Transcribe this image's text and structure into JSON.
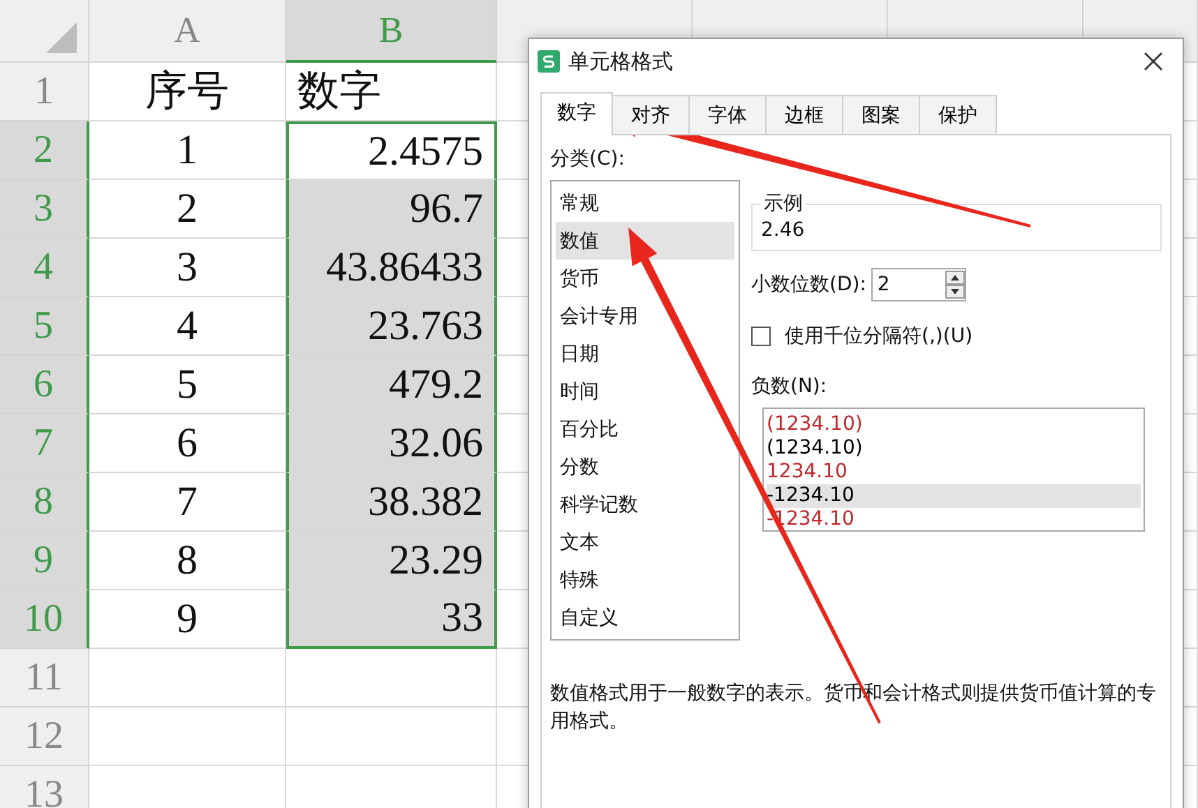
{
  "sheet": {
    "columns": [
      {
        "label": "A",
        "selected": false
      },
      {
        "label": "B",
        "selected": true
      }
    ],
    "rows": [
      {
        "header": "1",
        "selected": false,
        "cells": [
          {
            "text": "序号",
            "selected": false
          },
          {
            "text": "数字",
            "selected": false
          }
        ]
      },
      {
        "header": "2",
        "selected": true,
        "cells": [
          {
            "text": "1",
            "selected": false
          },
          {
            "text": "2.4575",
            "selected": true
          }
        ]
      },
      {
        "header": "3",
        "selected": true,
        "cells": [
          {
            "text": "2",
            "selected": false
          },
          {
            "text": "96.7",
            "selected": true
          }
        ]
      },
      {
        "header": "4",
        "selected": true,
        "cells": [
          {
            "text": "3",
            "selected": false
          },
          {
            "text": "43.86433",
            "selected": true
          }
        ]
      },
      {
        "header": "5",
        "selected": true,
        "cells": [
          {
            "text": "4",
            "selected": false
          },
          {
            "text": "23.763",
            "selected": true
          }
        ]
      },
      {
        "header": "6",
        "selected": true,
        "cells": [
          {
            "text": "5",
            "selected": false
          },
          {
            "text": "479.2",
            "selected": true
          }
        ]
      },
      {
        "header": "7",
        "selected": true,
        "cells": [
          {
            "text": "6",
            "selected": false
          },
          {
            "text": "32.06",
            "selected": true
          }
        ]
      },
      {
        "header": "8",
        "selected": true,
        "cells": [
          {
            "text": "7",
            "selected": false
          },
          {
            "text": "38.382",
            "selected": true
          }
        ]
      },
      {
        "header": "9",
        "selected": true,
        "cells": [
          {
            "text": "8",
            "selected": false
          },
          {
            "text": "23.29",
            "selected": true
          }
        ]
      },
      {
        "header": "10",
        "selected": true,
        "cells": [
          {
            "text": "9",
            "selected": false
          },
          {
            "text": "33",
            "selected": true
          }
        ]
      },
      {
        "header": "11",
        "selected": false,
        "cells": []
      },
      {
        "header": "12",
        "selected": false,
        "cells": []
      },
      {
        "header": "13",
        "selected": false,
        "cells": []
      }
    ]
  },
  "dialog": {
    "title": "单元格格式",
    "tabs": [
      {
        "label": "数字",
        "selected": true
      },
      {
        "label": "对齐",
        "selected": false
      },
      {
        "label": "字体",
        "selected": false
      },
      {
        "label": "边框",
        "selected": false
      },
      {
        "label": "图案",
        "selected": false
      },
      {
        "label": "保护",
        "selected": false
      }
    ],
    "category_label": "分类(C):",
    "categories": [
      {
        "label": "常规",
        "selected": false
      },
      {
        "label": "数值",
        "selected": true
      },
      {
        "label": "货币",
        "selected": false
      },
      {
        "label": "会计专用",
        "selected": false
      },
      {
        "label": "日期",
        "selected": false
      },
      {
        "label": "时间",
        "selected": false
      },
      {
        "label": "百分比",
        "selected": false
      },
      {
        "label": "分数",
        "selected": false
      },
      {
        "label": "科学记数",
        "selected": false
      },
      {
        "label": "文本",
        "selected": false
      },
      {
        "label": "特殊",
        "selected": false
      },
      {
        "label": "自定义",
        "selected": false
      }
    ],
    "sample": {
      "title": "示例",
      "value": "2.46"
    },
    "decimal_places": {
      "label": "小数位数(D):",
      "value": "2"
    },
    "thousands_separator": {
      "label": "使用千位分隔符(,)(U)",
      "checked": false
    },
    "negative_label": "负数(N):",
    "negative_formats": [
      {
        "text": "(1234.10)",
        "color": "#c0282d",
        "selected": false
      },
      {
        "text": "(1234.10)",
        "color": "#000000",
        "selected": false
      },
      {
        "text": "1234.10",
        "color": "#c0282d",
        "selected": false
      },
      {
        "text": "-1234.10",
        "color": "#000000",
        "selected": true
      },
      {
        "text": "-1234.10",
        "color": "#c0282d",
        "selected": false
      }
    ],
    "description": "数值格式用于一般数字的表示。货币和会计格式则提供货币值计算的专用格式。"
  }
}
